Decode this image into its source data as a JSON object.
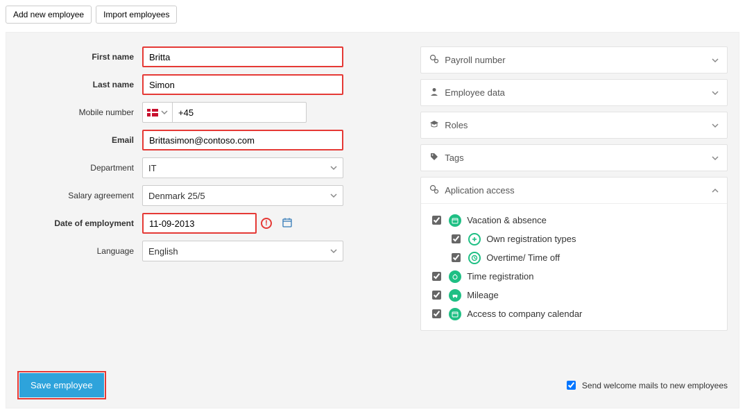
{
  "topButtons": {
    "add": "Add new employee",
    "import": "Import employees"
  },
  "form": {
    "firstNameLabel": "First name",
    "firstName": "Britta",
    "lastNameLabel": "Last name",
    "lastName": "Simon",
    "mobileLabel": "Mobile number",
    "mobilePrefix": "+45",
    "emailLabel": "Email",
    "email": "Brittasimon@contoso.com",
    "departmentLabel": "Department",
    "department": "IT",
    "salaryLabel": "Salary agreement",
    "salary": "Denmark 25/5",
    "dateLabel": "Date of employment",
    "date": "11-09-2013",
    "languageLabel": "Language",
    "language": "English"
  },
  "panels": {
    "payroll": "Payroll number",
    "employeeData": "Employee data",
    "roles": "Roles",
    "tags": "Tags",
    "appAccess": "Aplication access"
  },
  "access": {
    "vacation": "Vacation & absence",
    "ownReg": "Own registration types",
    "overtime": "Overtime/ Time off",
    "timeReg": "Time registration",
    "mileage": "Mileage",
    "calendar": "Access to company calendar"
  },
  "bottom": {
    "save": "Save employee",
    "welcome": "Send welcome mails to new employees"
  }
}
